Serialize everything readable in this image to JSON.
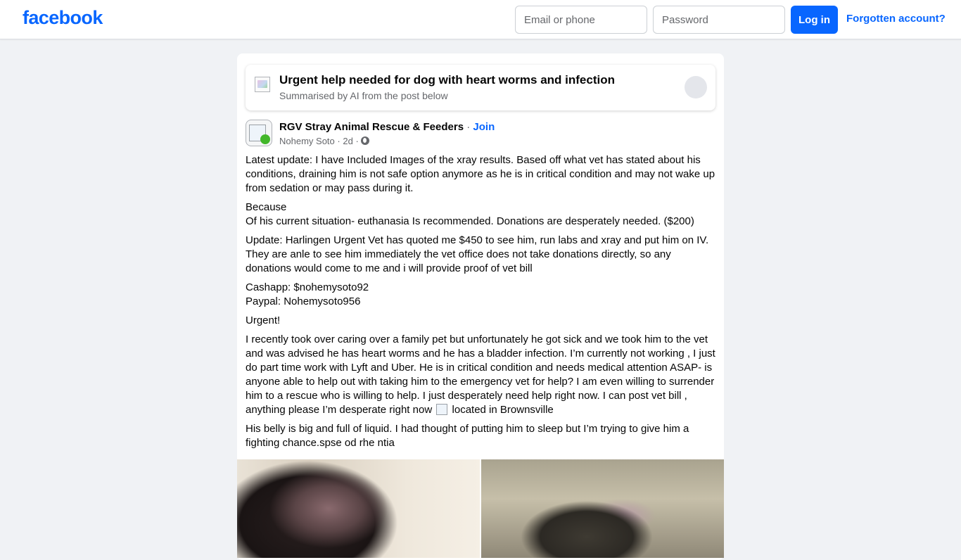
{
  "header": {
    "logo": "facebook",
    "email_placeholder": "Email or phone",
    "password_placeholder": "Password",
    "login_label": "Log in",
    "forgot_label": "Forgotten account?"
  },
  "summary": {
    "title": "Urgent help needed for dog with heart worms and infection",
    "subtitle": "Summarised by AI from the post below"
  },
  "post": {
    "group_name": "RGV Stray Animal Rescue & Feeders",
    "separator": "·",
    "join_label": "Join",
    "author": "Nohemy Soto",
    "time": "2d",
    "paragraphs": [
      "Latest update: I have Included Images of the xray results. Based off what vet has stated about his conditions, draining him is not safe option anymore as he is in critical condition and may not wake up from sedation or may pass during it.",
      "Because\nOf his current situation- euthanasia Is recommended. Donations are desperately needed. ($200)",
      "Update: Harlingen Urgent Vet has  quoted me $450 to see him, run labs and  xray and put him on IV. They are anle to see him immediately the vet office does not take donations directly, so any donations would come to me and i will provide proof of vet bill",
      "Cashapp: $nohemysoto92\nPaypal: Nohemysoto956",
      "Urgent!"
    ],
    "paragraph_long_before_img": "I recently took over caring over a family pet but unfortunately he got sick and we took him to the vet and was advised he has heart worms and he has a bladder infection. I’m currently not working , I just do part time work with Lyft and Uber. He is in critical condition and needs medical attention ASAP- is anyone able to help out with taking him to the emergency vet for help? I am even willing to surrender him to a rescue who is willing to help. I just desperately need help right now. I can post vet bill , anything please I’m desperate right now",
    "paragraph_long_after_img": "located in Brownsville",
    "paragraph_last": "His belly is big and full of liquid. I had thought of putting him to sleep but I’m trying to give him a fighting chance.spse od rhe ntia"
  },
  "colors": {
    "brand": "#0866ff",
    "background": "#f0f2f5",
    "secondary_text": "#65676b"
  },
  "icons": {
    "globe": "globe-icon"
  }
}
